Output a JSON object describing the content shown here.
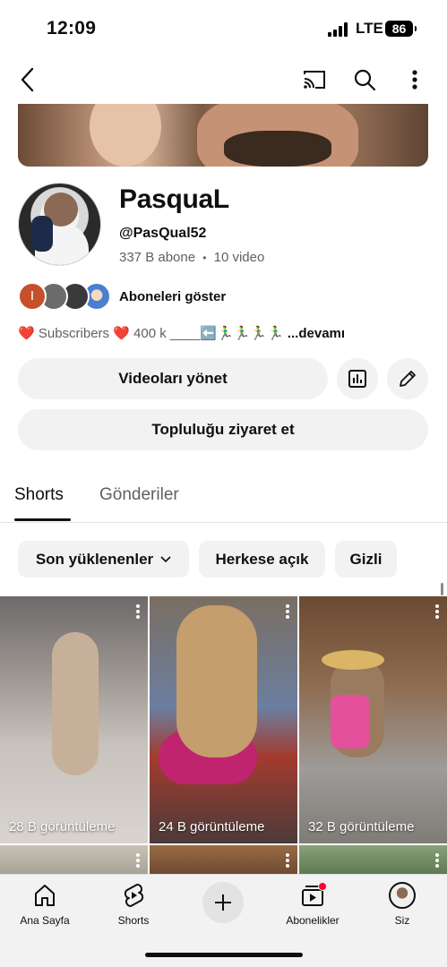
{
  "status_bar": {
    "time": "12:09",
    "network": "LTE",
    "battery": "86"
  },
  "topbar": {
    "back_icon": "chevron-left-icon",
    "cast_icon": "cast-icon",
    "search_icon": "search-icon",
    "more_icon": "more-vertical-icon"
  },
  "channel": {
    "name": "PasquaL",
    "handle": "@PasQual52",
    "subscribers": "337 B abone",
    "separator": "•",
    "videos": "10 video",
    "show_subscribers": "Aboneleri göster",
    "description": "❤️ Subscribers ❤️ 400 k ____⬅️🏃‍♂️🏃‍♂️🏃‍♂️🏃‍♂️",
    "description_more": "...devamı"
  },
  "actions": {
    "manage_videos": "Videoları yönet",
    "analytics_icon": "analytics-icon",
    "edit_icon": "pencil-icon",
    "visit_community": "Topluluğu ziyaret et"
  },
  "tabs": [
    {
      "label": "Shorts",
      "active": true
    },
    {
      "label": "Gönderiler",
      "active": false
    }
  ],
  "filters": {
    "sort": "Son yüklenenler",
    "public": "Herkese açık",
    "private": "Gizli"
  },
  "shorts": [
    {
      "views": "28 B görüntüleme"
    },
    {
      "views": "24 B görüntüleme"
    },
    {
      "views": "32 B görüntüleme"
    }
  ],
  "subscriber_avatars": [
    {
      "letter": "I",
      "color": "#c5502c"
    },
    {
      "color": "#6b6b6b"
    },
    {
      "color": "#3a3a3a"
    },
    {
      "color": "#4a7fd1"
    }
  ],
  "bottom_nav": {
    "home": "Ana Sayfa",
    "shorts": "Shorts",
    "subscriptions": "Abonelikler",
    "you": "Siz"
  },
  "colors": {
    "accent": "#0f0f0f",
    "notification": "#ff0033",
    "chip_bg": "#f2f2f2",
    "secondary_text": "#606060"
  }
}
